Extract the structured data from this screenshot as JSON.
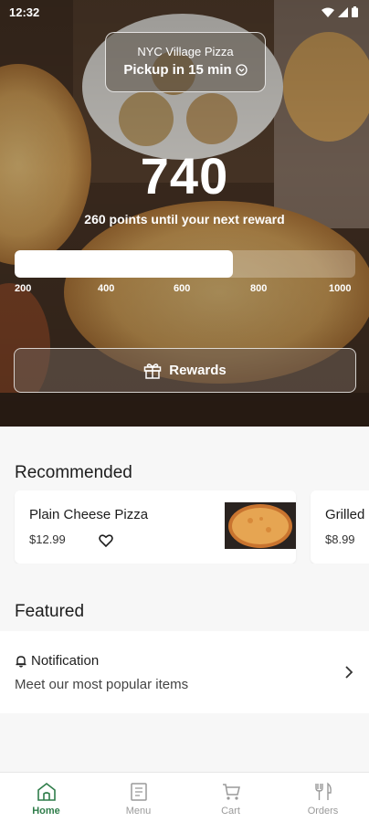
{
  "status_bar": {
    "time": "12:32"
  },
  "store": {
    "name": "NYC Village Pizza",
    "pickup": "Pickup in 15 min"
  },
  "rewards": {
    "points": "740",
    "subtitle": "260 points until your next reward",
    "progress_fraction": 0.64,
    "ticks": [
      "200",
      "400",
      "600",
      "800",
      "1000"
    ],
    "button_label": "Rewards"
  },
  "recommended": {
    "title": "Recommended",
    "items": [
      {
        "name": "Plain Cheese Pizza",
        "price": "$12.99"
      },
      {
        "name": "Grilled",
        "price": "$8.99"
      }
    ]
  },
  "featured": {
    "title": "Featured",
    "items": [
      {
        "title": "Notification",
        "subtitle": "Meet our most popular items"
      }
    ]
  },
  "nav": {
    "items": [
      {
        "label": "Home",
        "icon": "home-icon",
        "active": true
      },
      {
        "label": "Menu",
        "icon": "menu-icon",
        "active": false
      },
      {
        "label": "Cart",
        "icon": "cart-icon",
        "active": false
      },
      {
        "label": "Orders",
        "icon": "orders-icon",
        "active": false
      }
    ]
  },
  "colors": {
    "accent": "#2f7d4a",
    "inactive": "#9a9a9a"
  }
}
